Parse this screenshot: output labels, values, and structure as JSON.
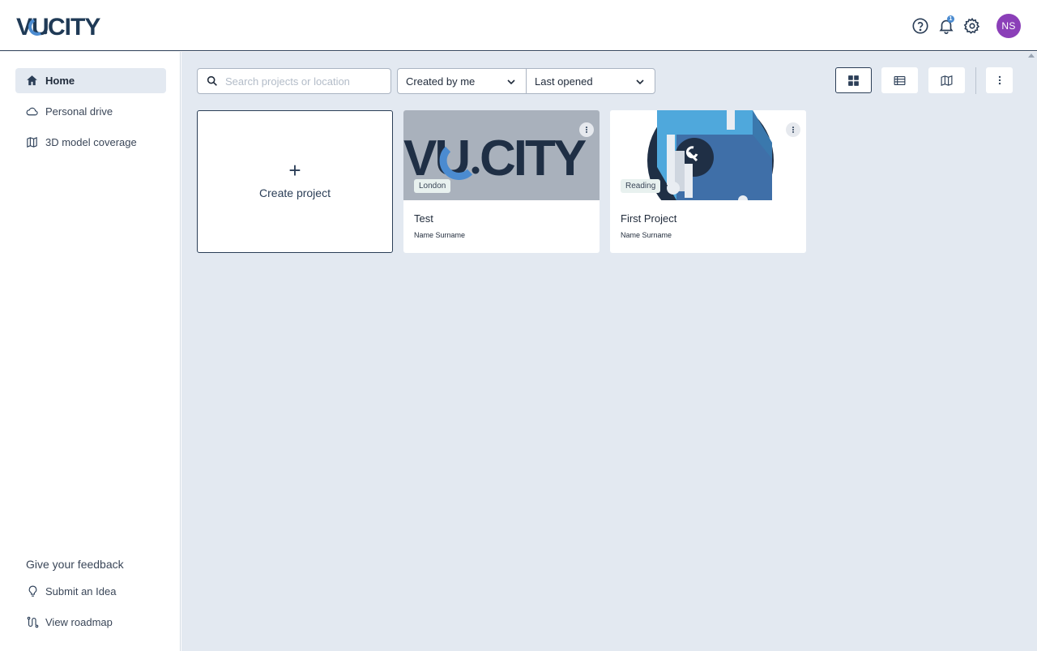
{
  "header": {
    "logo_text": "VU.CITY",
    "notification_count": "1",
    "avatar_initials": "NS"
  },
  "sidebar": {
    "items": [
      {
        "label": "Home",
        "icon": "home-icon",
        "active": true
      },
      {
        "label": "Personal drive",
        "icon": "cloud-icon",
        "active": false
      },
      {
        "label": "3D model coverage",
        "icon": "map-coverage-icon",
        "active": false
      }
    ],
    "feedback": {
      "title": "Give your feedback",
      "submit_idea": "Submit an Idea",
      "view_roadmap": "View roadmap"
    }
  },
  "toolbar": {
    "search_placeholder": "Search projects or location",
    "filter_owner": "Created by me",
    "sort_by": "Last opened",
    "views": [
      "grid-view-icon",
      "list-view-icon",
      "map-view-icon"
    ],
    "active_view": "grid"
  },
  "create_card": {
    "label": "Create project"
  },
  "projects": [
    {
      "title": "Test",
      "owner": "Name Surname",
      "location": "London",
      "thumb": "vucity-logo"
    },
    {
      "title": "First Project",
      "owner": "Name Surname",
      "location": "Reading",
      "thumb": "isometric-city"
    }
  ],
  "colors": {
    "navy": "#2b3e57",
    "accent_blue": "#4b8bd0",
    "background": "#e3e9f1",
    "avatar": "#8b3fb8"
  }
}
